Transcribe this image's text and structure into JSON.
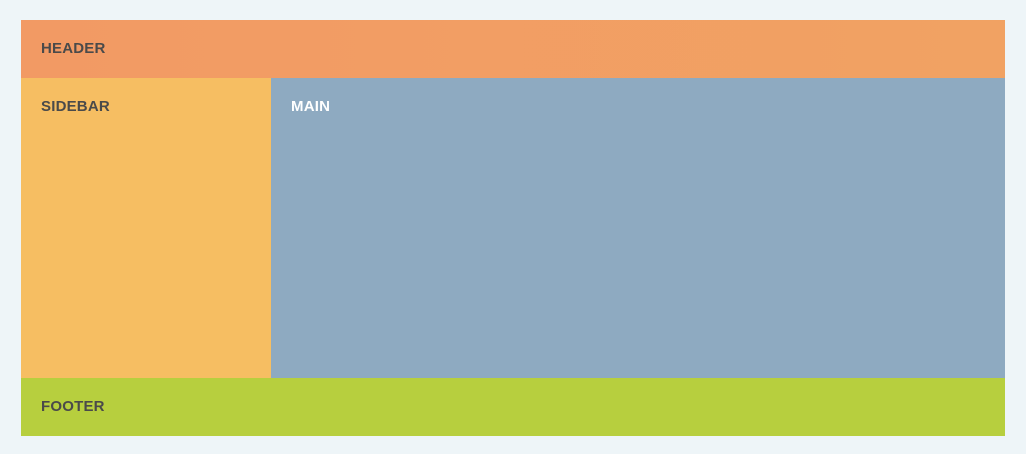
{
  "layout": {
    "header": {
      "label": "HEADER",
      "color": "#f2a063"
    },
    "sidebar": {
      "label": "SIDEBAR",
      "color": "#f6be62"
    },
    "main": {
      "label": "MAIN",
      "color": "#8eaac1"
    },
    "footer": {
      "label": "FOOTER",
      "color": "#b7cf3e"
    }
  }
}
